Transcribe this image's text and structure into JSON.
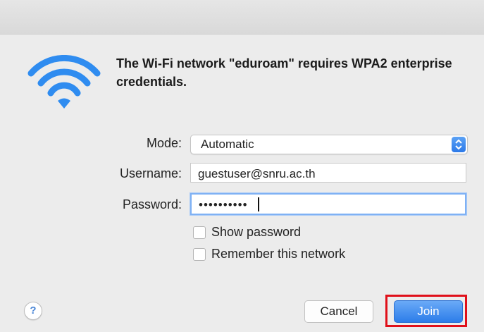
{
  "dialog": {
    "message": "The Wi-Fi network \"eduroam\" requires WPA2 enterprise credentials."
  },
  "form": {
    "mode_label": "Mode:",
    "mode_value": "Automatic",
    "username_label": "Username:",
    "username_value": "guestuser@snru.ac.th",
    "password_label": "Password:",
    "password_value": "••••••••••",
    "show_password_label": "Show password",
    "show_password_checked": false,
    "remember_label": "Remember this network",
    "remember_checked": false
  },
  "buttons": {
    "help": "?",
    "cancel": "Cancel",
    "join": "Join"
  },
  "icons": {
    "wifi": "wifi-icon",
    "help": "question-mark-icon",
    "select_arrows": "chevron-up-down-icon"
  },
  "colors": {
    "accent": "#2d7de9",
    "wifi": "#2f8cf0",
    "highlight": "#e0101a"
  }
}
